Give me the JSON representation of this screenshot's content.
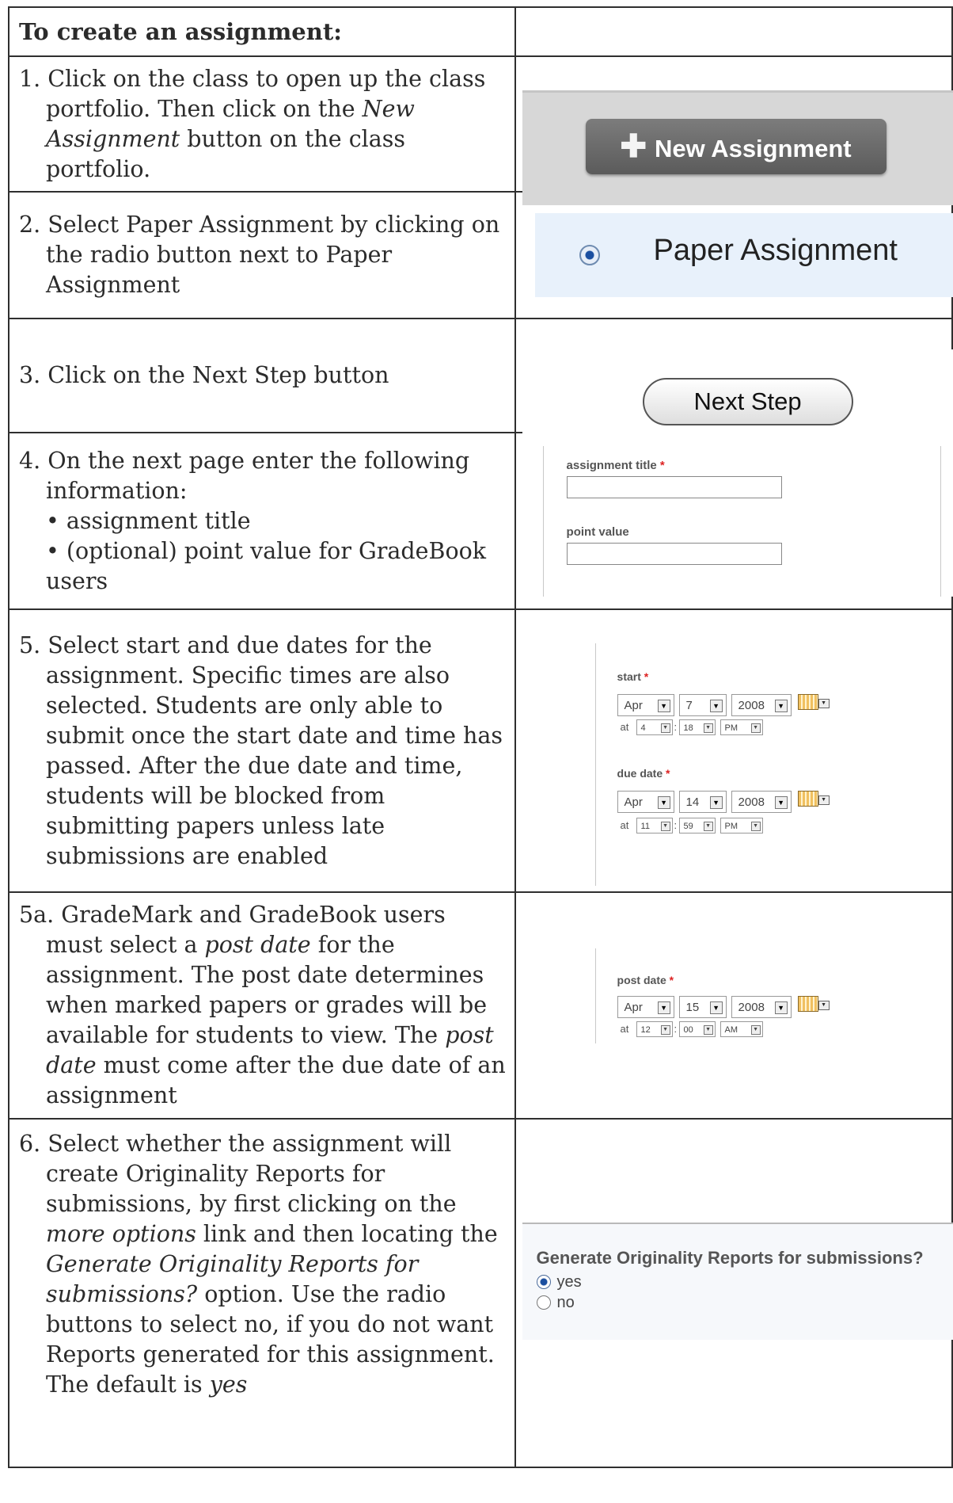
{
  "header": {
    "left": "To create an assignment:",
    "right": ""
  },
  "steps": [
    {
      "num": "1.",
      "lines": [
        "Click on the class to open up the class portfolio. Then click on the",
        "New Assignment",
        " button on the class portfolio."
      ],
      "screenshot": {
        "button_label": "New Assignment",
        "icon": "plus-icon"
      }
    },
    {
      "num": "2.",
      "text": "Select Paper Assignment by clicking on the radio button next to Paper Assignment",
      "screenshot": {
        "radio_label": "Paper Assignment"
      }
    },
    {
      "num": "3.",
      "text": "Click on the Next Step button",
      "screenshot": {
        "button_label": "Next Step"
      }
    },
    {
      "num": "4.",
      "text": "On the next page enter the following information:",
      "bullets": [
        "• assignment title",
        "• (optional) point value for GradeBook users"
      ],
      "screenshot": {
        "title_label": "assignment title",
        "required": "*",
        "point_label": "point value"
      }
    },
    {
      "num": "5.",
      "text": "Select start and due dates for the assignment. Specific times are also selected. Students are only able to submit once the start date and time has passed. After the due date and time, students will be blocked from submitting papers unless late submissions are enabled",
      "screenshot": {
        "start_label": "start",
        "due_label": "due date",
        "required": "*",
        "at": "at",
        "colon": ":",
        "start": {
          "month": "Apr",
          "day": "7",
          "year": "2008",
          "hour": "4",
          "minute": "18",
          "ampm": "PM"
        },
        "due": {
          "month": "Apr",
          "day": "14",
          "year": "2008",
          "hour": "11",
          "minute": "59",
          "ampm": "PM"
        }
      }
    },
    {
      "num": "5a.",
      "parts": [
        "GradeMark and GradeBook users must select a ",
        "post date",
        " for the assignment. The post date determines when marked papers or grades will be available for students to view. The ",
        "post date",
        " must come after the due date of an assignment"
      ],
      "screenshot": {
        "post_label": "post date",
        "required": "*",
        "at": "at",
        "colon": ":",
        "post": {
          "month": "Apr",
          "day": "15",
          "year": "2008",
          "hour": "12",
          "minute": "00",
          "ampm": "AM"
        }
      }
    },
    {
      "num": "6.",
      "parts": [
        "Select whether the assignment will create Originality Reports for submissions, by first clicking on the ",
        "more options",
        " link and then locating the ",
        "Generate Originality Reports for submissions?",
        " option. Use the radio buttons to select no, if you do not want Reports generated for this assignment. The default is ",
        "yes"
      ],
      "screenshot": {
        "question": "Generate Originality Reports for submissions?",
        "yes": "yes",
        "no": "no"
      }
    }
  ]
}
